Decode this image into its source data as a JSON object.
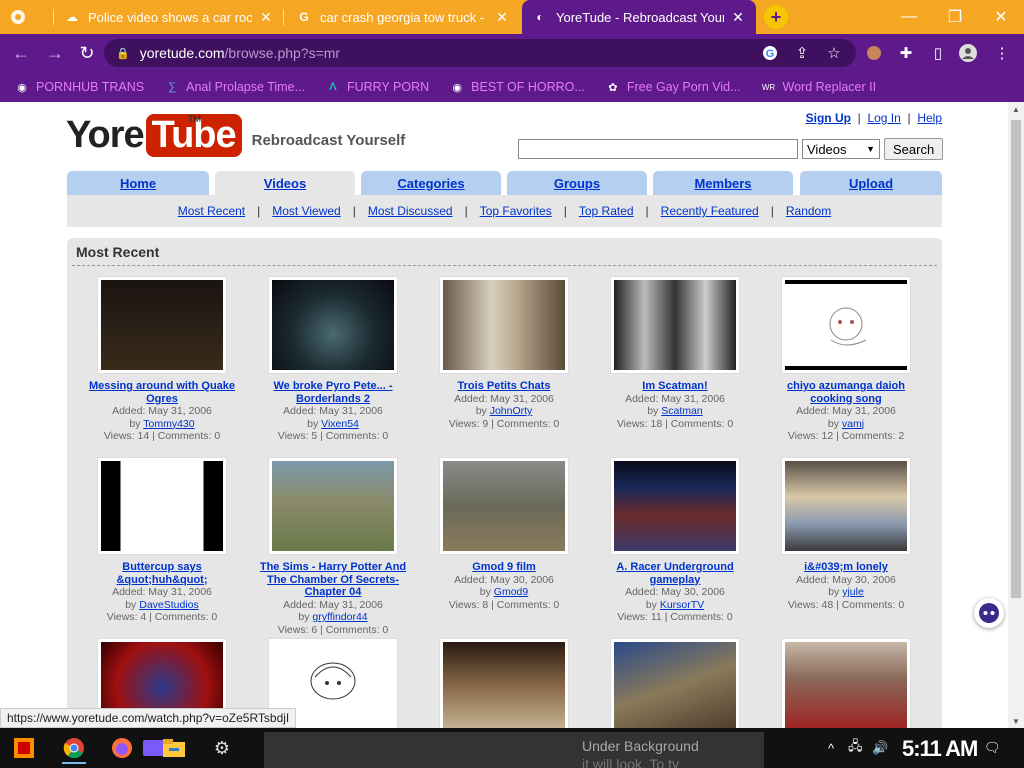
{
  "tabs": [
    {
      "title": "Police video shows a car rocke",
      "active": false
    },
    {
      "title": "car crash georgia tow truck - G",
      "active": false
    },
    {
      "title": "YoreTude - Rebroadcast Yours",
      "active": true
    }
  ],
  "address": {
    "domain": "yoretude.com",
    "path": "/browse.php?s=mr"
  },
  "bookmarks": [
    "PORNHUB TRANS",
    "Anal Prolapse Time...",
    "FURRY PORN",
    "BEST OF HORRO...",
    "Free Gay Porn Vid...",
    "Word Replacer II"
  ],
  "site": {
    "logo_a": "Yore",
    "logo_b": "Tube",
    "tm": "TM",
    "slogan": "Rebroadcast Yourself",
    "signup": "Sign Up",
    "login": "Log In",
    "help": "Help",
    "search_type": "Videos",
    "search_btn": "Search"
  },
  "nav": [
    "Home",
    "Videos",
    "Categories",
    "Groups",
    "Members",
    "Upload"
  ],
  "subnav": [
    "Most Recent",
    "Most Viewed",
    "Most Discussed",
    "Top Favorites",
    "Top Rated",
    "Recently Featured",
    "Random"
  ],
  "section_title": "Most Recent",
  "videos": [
    {
      "title": "Messing around with Quake Ogres",
      "added": "Added: May 31, 2006",
      "by": "by",
      "user": "Tommy430",
      "views": "Views: 14 | Comments: 0"
    },
    {
      "title": "We broke Pyro Pete... - Borderlands 2",
      "added": "Added: May 31, 2006",
      "by": "by",
      "user": "Vixen54",
      "views": "Views: 5 | Comments: 0"
    },
    {
      "title": "Trois Petits Chats",
      "added": "Added: May 31, 2006",
      "by": "by",
      "user": "JohnOrty",
      "views": "Views: 9 | Comments: 0"
    },
    {
      "title": "Im Scatman!",
      "added": "Added: May 31, 2006",
      "by": "by",
      "user": "Scatman",
      "views": "Views: 18 | Comments: 0"
    },
    {
      "title": "chiyo azumanga daioh cooking song",
      "added": "Added: May 31, 2006",
      "by": "by",
      "user": "vamj",
      "views": "Views: 12 | Comments: 2"
    },
    {
      "title": "Buttercup says &quot;huh&quot;",
      "added": "Added: May 31, 2006",
      "by": "by",
      "user": "DaveStudios",
      "views": "Views: 4 | Comments: 0"
    },
    {
      "title": "The Sims - Harry Potter And The Chamber Of Secrets-Chapter 04",
      "added": "Added: May 31, 2006",
      "by": "by",
      "user": "gryffindor44",
      "views": "Views: 6 | Comments: 0"
    },
    {
      "title": "Gmod 9 film",
      "added": "Added: May 30, 2006",
      "by": "by",
      "user": "Gmod9",
      "views": "Views: 8 | Comments: 0"
    },
    {
      "title": "A. Racer Underground gameplay",
      "added": "Added: May 30, 2006",
      "by": "by",
      "user": "KursorTV",
      "views": "Views: 11 | Comments: 0"
    },
    {
      "title": "i&#039;m lonely",
      "added": "Added: May 30, 2006",
      "by": "by",
      "user": "yjule",
      "views": "Views: 48 | Comments: 0"
    }
  ],
  "status_url": "https://www.yoretude.com/watch.php?v=oZe5RTsbdjI",
  "taskbar": {
    "bg_text_1": "Under Background",
    "bg_text_2": "it will look. To ty",
    "clock": "5:11 AM"
  }
}
